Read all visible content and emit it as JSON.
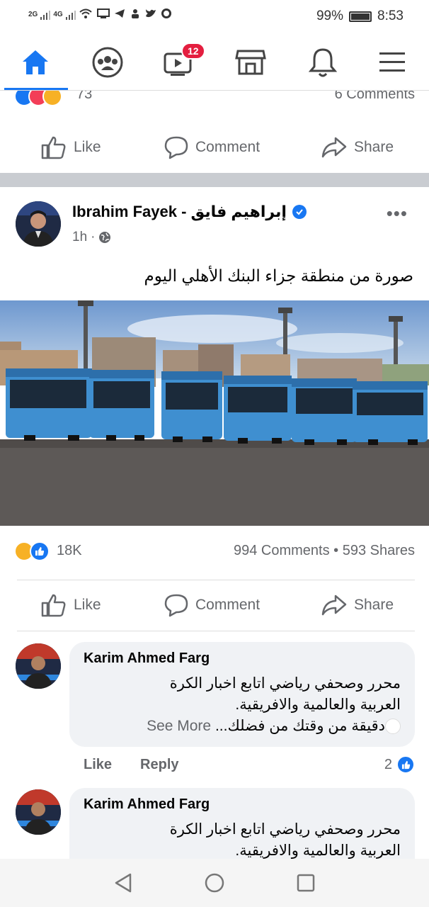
{
  "status_bar": {
    "left_labels": [
      "2G",
      "4G"
    ],
    "battery": "99%",
    "time": "8:53"
  },
  "nav": {
    "items": [
      {
        "name": "home",
        "icon": "home-icon",
        "active": true
      },
      {
        "name": "groups",
        "icon": "groups-icon"
      },
      {
        "name": "watch",
        "icon": "video-icon",
        "badge": "12"
      },
      {
        "name": "marketplace",
        "icon": "shop-icon"
      },
      {
        "name": "notifications",
        "icon": "bell-icon"
      },
      {
        "name": "menu",
        "icon": "menu-icon"
      }
    ],
    "accent": "#1877f2"
  },
  "prev_post": {
    "reaction_count": "73",
    "comments": "6 Comments"
  },
  "actions": {
    "like": "Like",
    "comment": "Comment",
    "share": "Share"
  },
  "post": {
    "author": "Ibrahim Fayek - إبراهيم فايق",
    "time": "1h",
    "text": "صورة من منطقة جزاء البنك الأهلي اليوم",
    "reactions_count": "18K",
    "comments_shares": "994 Comments • 593 Shares"
  },
  "comments": [
    {
      "name": "Karim Ahmed Farg",
      "line1": "محرر وصحفي رياضي   اتابع اخبار الكرة",
      "line2": "العربية والعالمية والافريقية.",
      "line3": "دقيقة من وقتك من فضلك...",
      "see_more": "See More",
      "like": "Like",
      "reply": "Reply",
      "likes": "2"
    },
    {
      "name": "Karim Ahmed Farg",
      "line1": "محرر وصحفي رياضي   اتابع اخبار الكرة",
      "line2": "العربية والعالمية والافريقية."
    }
  ]
}
